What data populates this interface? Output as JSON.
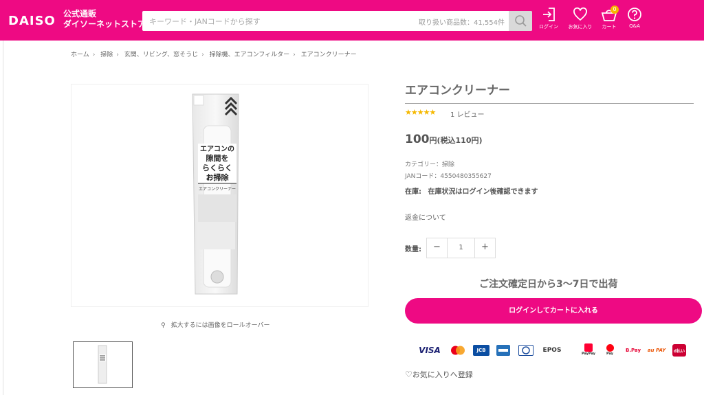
{
  "header": {
    "logo": "DAISO",
    "logo_sub_line1": "公式通販",
    "logo_sub_line2": "ダイソーネットストア",
    "search_placeholder": "キーワード・JANコードから探す",
    "search_count": "取り扱い商品数：41,554件",
    "icons": {
      "login": "ログイン",
      "favorites": "お気に入り",
      "cart": "カート",
      "cart_count": "0",
      "qa": "Q&A"
    }
  },
  "breadcrumb": [
    "ホーム",
    "掃除",
    "玄関、リビング、窓そうじ",
    "掃除機、エアコンフィルター",
    "エアコンクリーナー"
  ],
  "gallery": {
    "zoom_hint": "拡大するには画像をロールオーバー",
    "package_text": [
      "エアコンの",
      "隙間を",
      "らくらく",
      "お掃除"
    ],
    "package_name": "エアコンクリーナー"
  },
  "product": {
    "title": "エアコンクリーナー",
    "stars": "★★★★★",
    "rating": 5,
    "reviews": "1 レビュー",
    "price_main": "100",
    "price_suffix": "円(税込110円)",
    "category": "カテゴリー：掃除",
    "jan": "JANコード：4550480355627",
    "stock_label": "在庫:",
    "stock_value": "在庫状況はログイン後確認できます",
    "refund": "返金について",
    "qty_label": "数量:",
    "qty_minus": "−",
    "qty_value": "1",
    "qty_plus": "+",
    "shipping": "ご注文確定日から3〜7日で出荷",
    "cart_button": "ログインしてカートに入れる",
    "favorite": "お気に入りへ登録"
  },
  "payments": {
    "visa": "VISA",
    "jcb": "JCB",
    "epos": "EPOS",
    "paypay": "PayPay",
    "merpay": "Pay",
    "bpay": "B.Pay",
    "aupay": "au PAY",
    "dbarai": "d払い"
  },
  "colors": {
    "brand": "#ee0a83",
    "star": "#f5b800"
  }
}
